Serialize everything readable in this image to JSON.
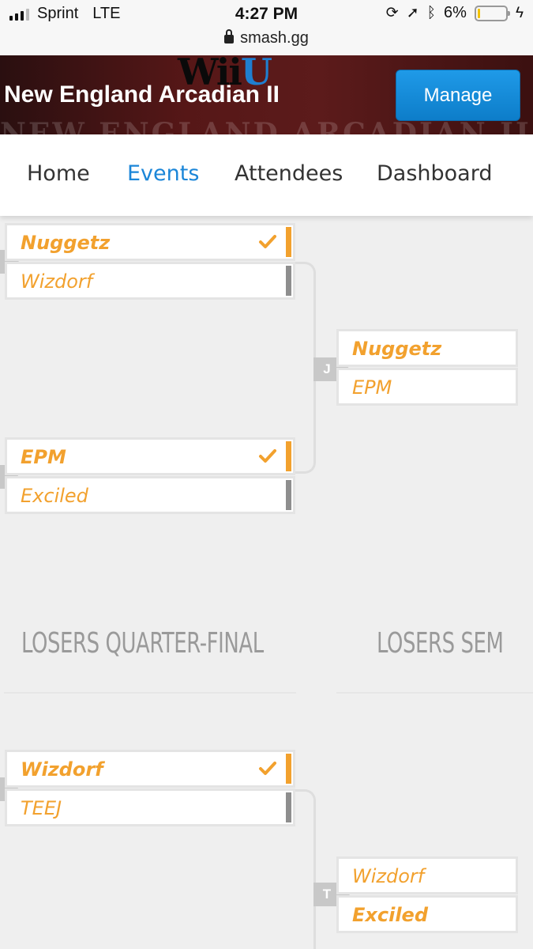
{
  "status_bar": {
    "carrier": "Sprint",
    "network": "LTE",
    "time": "4:27 PM",
    "url": "smash.gg",
    "battery": "6%",
    "battery_level": 0.06
  },
  "banner": {
    "title": "New England Arcadian II",
    "background_text": "NEW ENGLAND ARCADIAN II",
    "logo_text": "Wii",
    "logo_u": "U",
    "manage_label": "Manage"
  },
  "nav": {
    "tabs": [
      "Home",
      "Events",
      "Attendees",
      "Dashboard"
    ],
    "active": "Events"
  },
  "bracket": {
    "matches": [
      {
        "top": "Nuggetz",
        "bottom": "Wizdorf",
        "winner": "top"
      },
      {
        "top": "EPM",
        "bottom": "Exciled",
        "winner": "top"
      },
      {
        "tag": "J",
        "top": "Nuggetz",
        "bottom": "EPM"
      },
      {
        "top": "Wizdorf",
        "bottom": "TEEJ",
        "winner": "top"
      },
      {
        "tag": "T",
        "top": "Wizdorf",
        "bottom": "Exciled"
      }
    ],
    "round_headers": [
      "LOSERS QUARTER-FINAL",
      "LOSERS SEM"
    ]
  },
  "colors": {
    "accent": "#f2a12e",
    "link": "#1b86d8",
    "manage_button": "#1a8fdd"
  }
}
